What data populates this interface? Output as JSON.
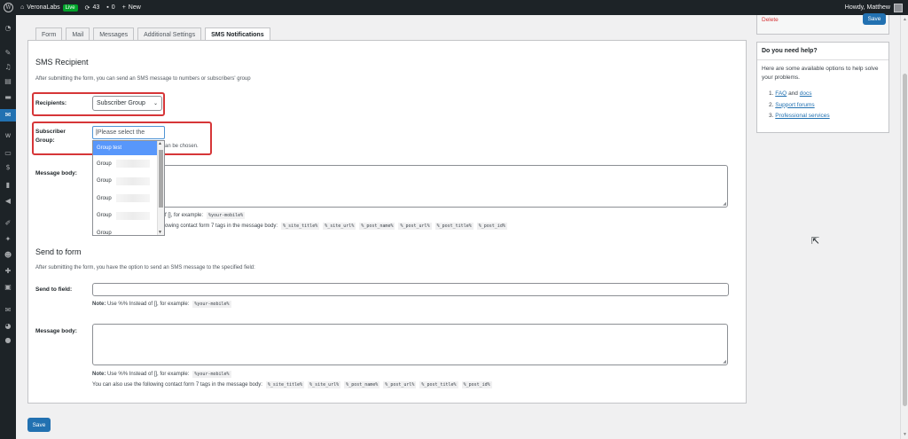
{
  "adminbar": {
    "site_name": "VeronaLabs",
    "live_badge": "Live",
    "updates_count": "43",
    "comments_count": "0",
    "new_label": "New",
    "howdy": "Howdy, Matthew"
  },
  "tabs": [
    {
      "label": "Form"
    },
    {
      "label": "Mail"
    },
    {
      "label": "Messages"
    },
    {
      "label": "Additional Settings"
    },
    {
      "label": "SMS Notifications",
      "active": true
    }
  ],
  "sms_recipient": {
    "title": "SMS Recipient",
    "description": "After submitting the form, you can send an SMS message to numbers or subscribers' group",
    "recipients_label": "Recipients:",
    "recipients_value": "Subscriber Group",
    "subscriber_group_label_1": "Subscriber",
    "subscriber_group_label_2": "Group:",
    "dropdown_search_placeholder": "Please select the",
    "hint_partial": "an be chosen.",
    "dropdown_options": [
      "Group test",
      "Group",
      "Group",
      "Group",
      "Group",
      "Group"
    ],
    "message_body_label": "Message body:",
    "note_partial": "f [], for example:",
    "note_code": "%your-mobile%",
    "tags_text_partial": "owing contact form 7 tags in the message body:",
    "tags": [
      "%_site_title%",
      "%_site_url%",
      "%_post_name%",
      "%_post_url%",
      "%_post_title%",
      "%_post_id%"
    ]
  },
  "send_to_form": {
    "title": "Send to form",
    "description": "After submitting the form, you have the option to send an SMS message to the specified field:",
    "send_to_field_label": "Send to field:",
    "note_bold": "Note:",
    "note_text": "Use %% Instead of [], for example:",
    "note_code": "%your-mobile%",
    "message_body_label": "Message body:",
    "note2_bold": "Note:",
    "note2_text": "Use %% Instead of [], for example:",
    "note2_code": "%your-mobile%",
    "tags_text": "You can also use the following contact form 7 tags in the message body:",
    "tags": [
      "%_site_title%",
      "%_site_url%",
      "%_post_name%",
      "%_post_url%",
      "%_post_title%",
      "%_post_id%"
    ]
  },
  "save_label": "Save",
  "publish": {
    "delete_label": "Delete",
    "save_label": "Save"
  },
  "help": {
    "title": "Do you need help?",
    "text": "Here are some available options to help solve your problems.",
    "items": [
      {
        "num": "1.",
        "link1": "FAQ",
        "and": "and",
        "link2": "docs"
      },
      {
        "num": "2.",
        "link": "Support forums"
      },
      {
        "num": "3.",
        "link": "Professional services"
      }
    ]
  },
  "colors": {
    "accent": "#2271b1",
    "highlight_border": "#d63638",
    "selected_option": "#5897fb"
  }
}
